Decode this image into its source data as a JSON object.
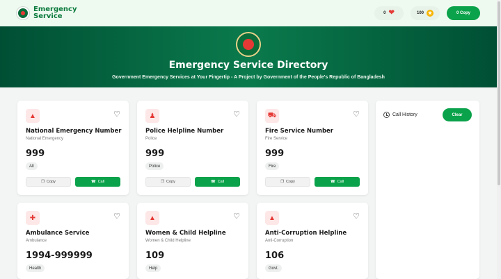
{
  "header": {
    "brand_line1": "Emergency",
    "brand_line2": "Service",
    "hearts_count": "0",
    "coins_count": "100",
    "copy_count_label": "0 Copy"
  },
  "hero": {
    "title": "Emergency Service Directory",
    "subtitle": "Government Emergency Services at Your Fingertip - A Project by Government of the People's Republic of Bangladesh"
  },
  "cards": [
    {
      "icon": "emergency-icon",
      "title": "National Emergency Number",
      "subtitle": "National Emergency",
      "number": "999",
      "tag": "All"
    },
    {
      "icon": "police-icon",
      "title": "Police Helpline Number",
      "subtitle": "Police",
      "number": "999",
      "tag": "Police"
    },
    {
      "icon": "fire-truck-icon",
      "title": "Fire Service Number",
      "subtitle": "Fire Service",
      "number": "999",
      "tag": "Fire"
    },
    {
      "icon": "ambulance-icon",
      "title": "Ambulance Service",
      "subtitle": "Ambulance",
      "number": "1994-999999",
      "tag": "Health"
    },
    {
      "icon": "emergency-icon",
      "title": "Women & Child Helpline",
      "subtitle": "Women & Child Helpline",
      "number": "109",
      "tag": "Help"
    },
    {
      "icon": "emergency-icon",
      "title": "Anti-Corruption Helpline",
      "subtitle": "Anti-Corruption",
      "number": "106",
      "tag": "Govt."
    }
  ],
  "card_buttons": {
    "copy": "Copy",
    "call": "Call"
  },
  "history": {
    "title": "Call History",
    "clear": "Clear"
  },
  "colors": {
    "primary_green": "#0aa24a",
    "hero_dark": "#004f34",
    "accent_red": "#e53935"
  }
}
